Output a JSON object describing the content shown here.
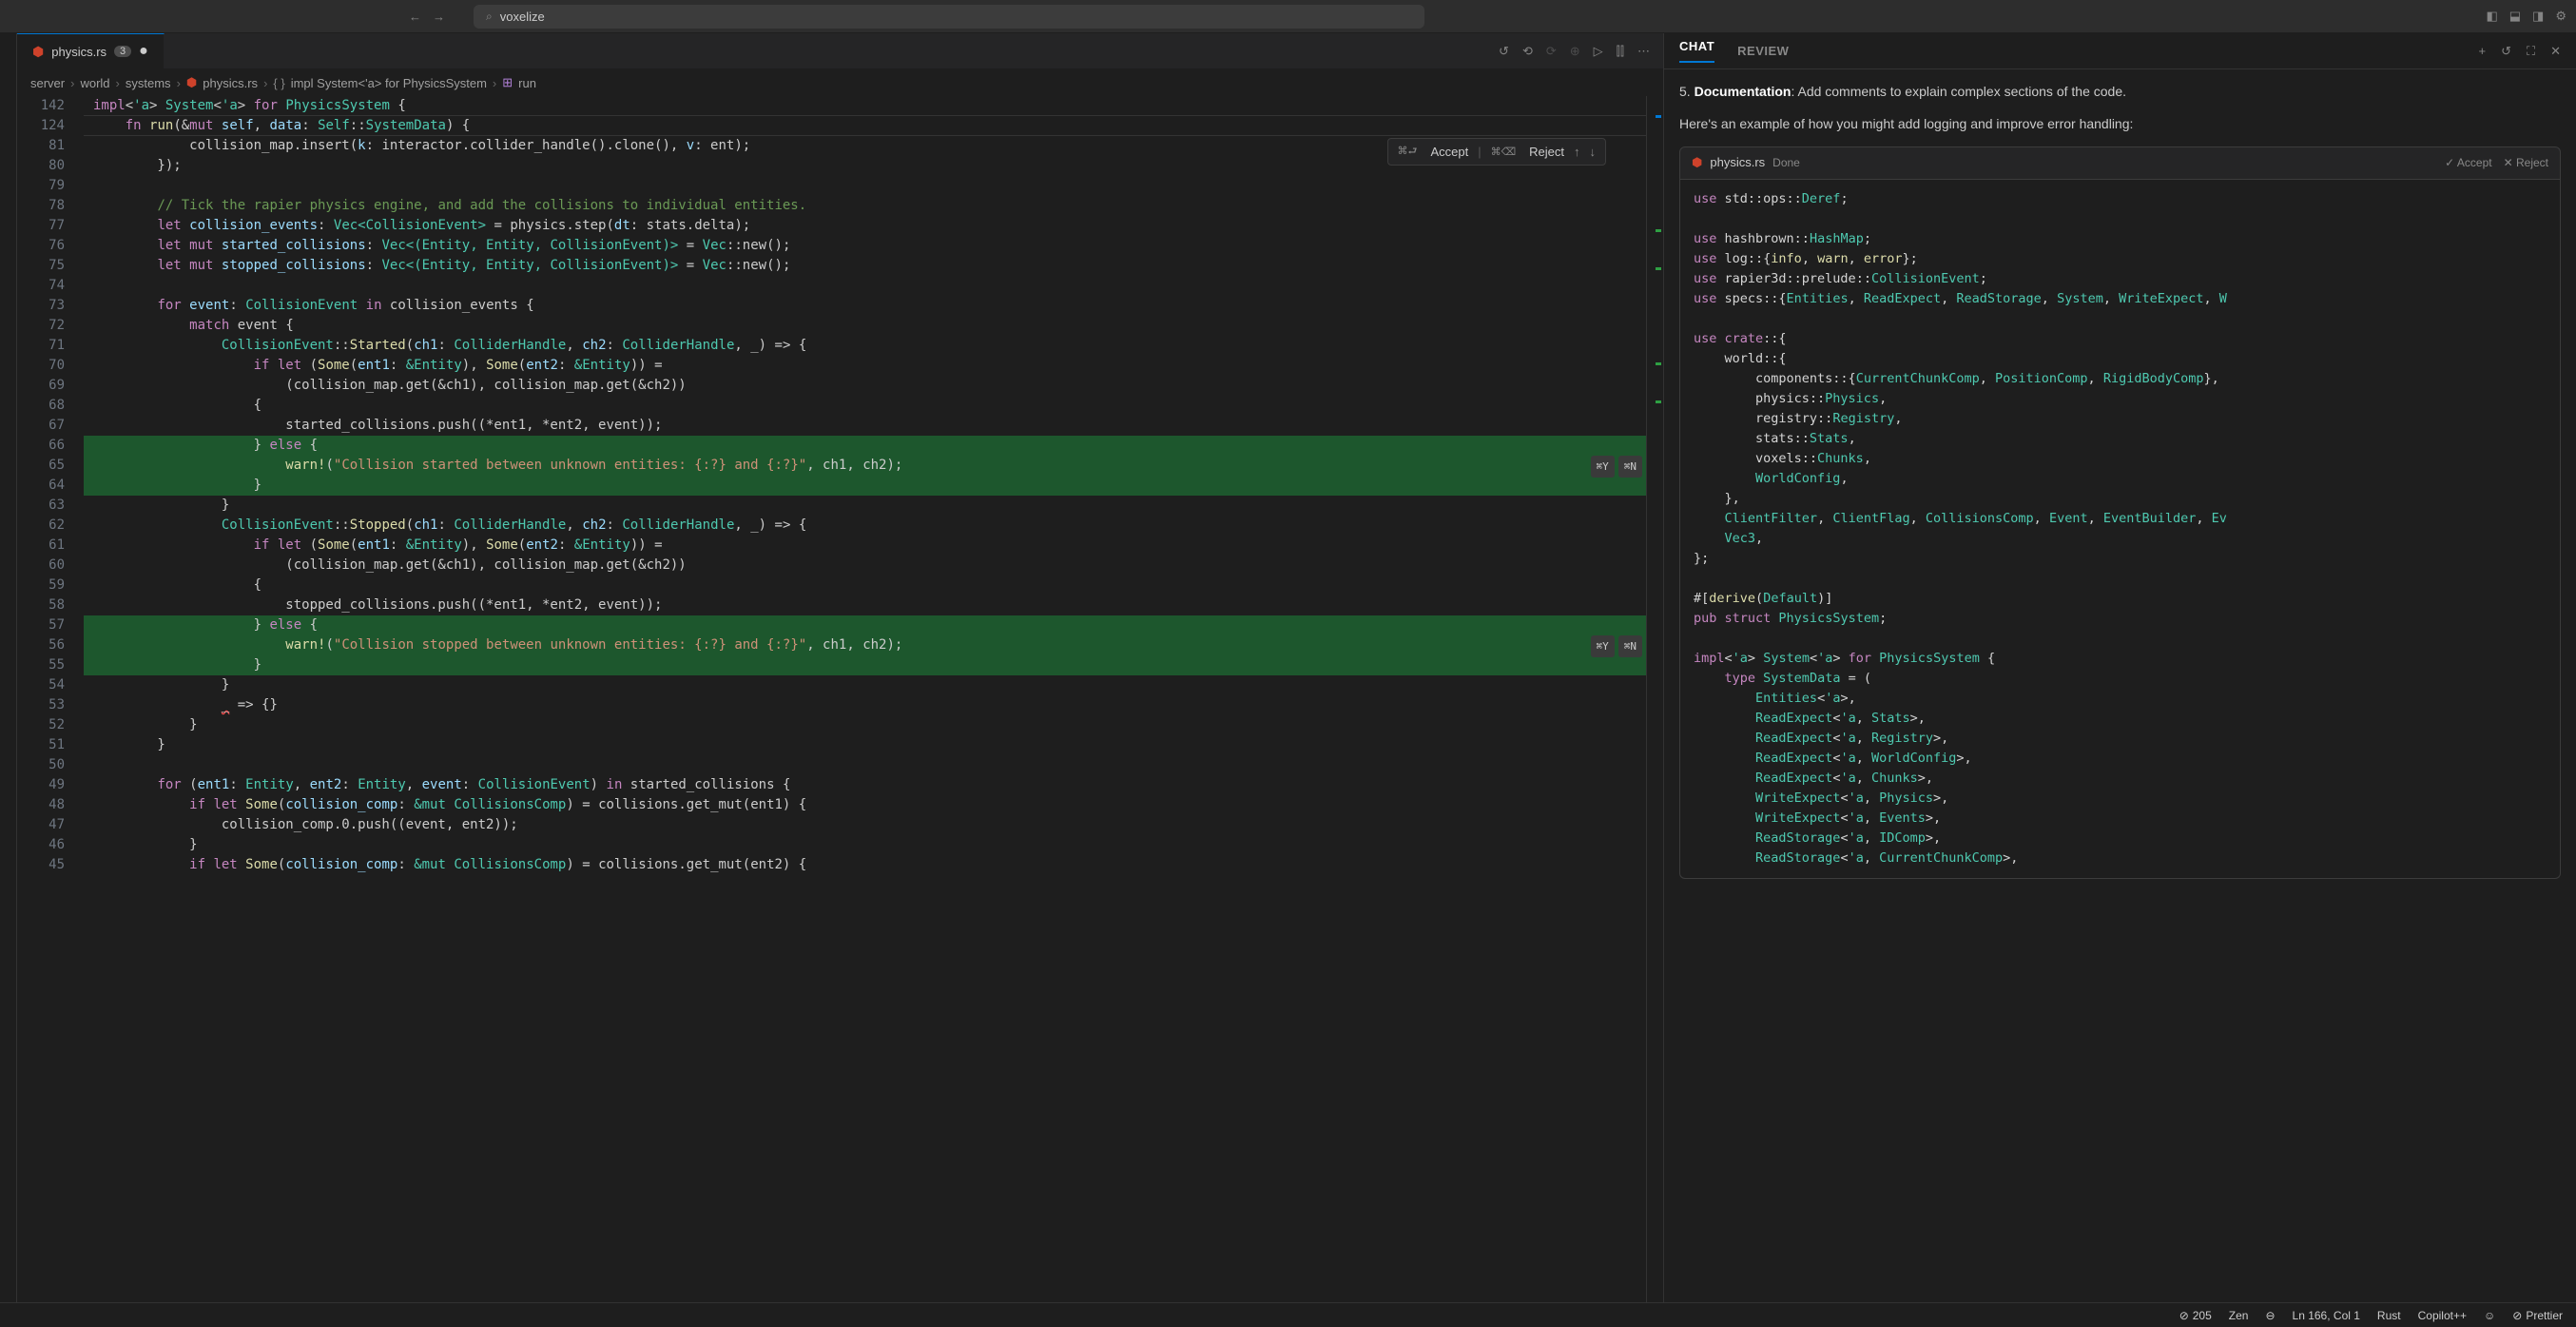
{
  "search_value": "voxelize",
  "tab": {
    "filename": "physics.rs",
    "badge": "3"
  },
  "breadcrumbs": [
    "server",
    "world",
    "systems",
    "physics.rs",
    "impl System<'a> for PhysicsSystem",
    "run"
  ],
  "accept_reject": {
    "accept_kbd": "⌘⮐",
    "accept": "Accept",
    "reject_kbd": "⌘⌫",
    "reject": "Reject"
  },
  "diff_hint": {
    "yes": "⌘Y",
    "no": "⌘N"
  },
  "gutter": [
    "142",
    "124",
    "",
    "81",
    "80",
    "79",
    "78",
    "77",
    "76",
    "75",
    "74",
    "73",
    "72",
    "71",
    "70",
    "69",
    "68",
    "67",
    "66",
    "65",
    "64",
    "63",
    "62",
    "61",
    "60",
    "59",
    "58",
    "57",
    "56",
    "55",
    "54",
    "53",
    "52",
    "51",
    "50",
    "49",
    "48",
    "47",
    "46",
    "45"
  ],
  "code": {
    "sticky1_html": "<span class='kw'>impl</span>&lt;<span class='ty'>'a</span>&gt; <span class='ty'>System</span>&lt;<span class='ty'>'a</span>&gt; <span class='kw'>for</span> <span class='ty'>PhysicsSystem</span> {",
    "sticky2_html": "    <span class='kw'>fn</span> <span class='fn-name'>run</span>(&amp;<span class='kw'>mut</span> <span class='var'>self</span>, <span class='var'>data</span>: <span class='ty'>Self</span>::<span class='ty'>SystemData</span>) {",
    "l3": "            collision_map.insert(<span class='var'>k</span>: interactor.collider_handle().clone(), <span class='var'>v</span>: ent);",
    "l4": "        });",
    "l5": "",
    "l6": "        <span class='cmt'>// Tick the rapier physics engine, and add the collisions to individual entities.</span>",
    "l7": "        <span class='kw'>let</span> <span class='var'>collision_events</span>: <span class='ty'>Vec&lt;CollisionEvent&gt;</span> = physics.step(<span class='var'>dt</span>: stats.delta);",
    "l8": "        <span class='kw'>let</span> <span class='kw'>mut</span> <span class='var'>started_collisions</span>: <span class='ty'>Vec&lt;(Entity, Entity, CollisionEvent)&gt;</span> = <span class='ty'>Vec</span>::new();",
    "l9": "        <span class='kw'>let</span> <span class='kw'>mut</span> <span class='var'>stopped_collisions</span>: <span class='ty'>Vec&lt;(Entity, Entity, CollisionEvent)&gt;</span> = <span class='ty'>Vec</span>::new();",
    "l10": "",
    "l11": "        <span class='kw'>for</span> <span class='var'>event</span>: <span class='ty'>CollisionEvent</span> <span class='kw'>in</span> collision_events {",
    "l12": "            <span class='kw'>match</span> event {",
    "l13": "                <span class='ty'>CollisionEvent</span>::<span class='fn-name'>Started</span>(<span class='var'>ch1</span>: <span class='ty'>ColliderHandle</span>, <span class='var'>ch2</span>: <span class='ty'>ColliderHandle</span>, _) =&gt; {",
    "l14": "                    <span class='kw'>if let</span> (<span class='fn-name'>Some</span>(<span class='var'>ent1</span>: <span class='ty'>&amp;Entity</span>), <span class='fn-name'>Some</span>(<span class='var'>ent2</span>: <span class='ty'>&amp;Entity</span>)) =",
    "l15": "                        (collision_map.get(&amp;ch1), collision_map.get(&amp;ch2))",
    "l16": "                    {",
    "l17": "                        started_collisions.push((*ent1, *ent2, event));",
    "l18": "                    } <span class='kw'>else</span> {",
    "l19": "                        <span class='fn-name'>warn!</span>(<span class='str'>\"Collision started between unknown entities: {:?} and {:?}\"</span>, ch1, ch2);",
    "l20": "                    }",
    "l21": "                }",
    "l22": "                <span class='ty'>CollisionEvent</span>::<span class='fn-name'>Stopped</span>(<span class='var'>ch1</span>: <span class='ty'>ColliderHandle</span>, <span class='var'>ch2</span>: <span class='ty'>ColliderHandle</span>, _) =&gt; {",
    "l23": "                    <span class='kw'>if let</span> (<span class='fn-name'>Some</span>(<span class='var'>ent1</span>: <span class='ty'>&amp;Entity</span>), <span class='fn-name'>Some</span>(<span class='var'>ent2</span>: <span class='ty'>&amp;Entity</span>)) =",
    "l24": "                        (collision_map.get(&amp;ch1), collision_map.get(&amp;ch2))",
    "l25": "                    {",
    "l26": "                        stopped_collisions.push((*ent1, *ent2, event));",
    "l27": "                    } <span class='kw'>else</span> {",
    "l28": "                        <span class='fn-name'>warn!</span>(<span class='str'>\"Collision stopped between unknown entities: {:?} and {:?}\"</span>, ch1, ch2);",
    "l29": "                    }",
    "l30": "                }",
    "l31": "                <span style='text-decoration:underline wavy #f14c4c;'>_</span> =&gt; {}",
    "l32": "            }",
    "l33": "        }",
    "l34": "",
    "l35": "        <span class='kw'>for</span> (<span class='var'>ent1</span>: <span class='ty'>Entity</span>, <span class='var'>ent2</span>: <span class='ty'>Entity</span>, <span class='var'>event</span>: <span class='ty'>CollisionEvent</span>) <span class='kw'>in</span> started_collisions {",
    "l36": "            <span class='kw'>if let</span> <span class='fn-name'>Some</span>(<span class='var'>collision_comp</span>: <span class='ty'>&amp;mut CollisionsComp</span>) = collisions.get_mut(ent1) {",
    "l37": "                collision_comp.0.push((event, ent2));",
    "l38": "            }",
    "l39": "            <span class='kw'>if let</span> <span class='fn-name'>Some</span>(<span class='var'>collision_comp</span>: <span class='ty'>&amp;mut CollisionsComp</span>) = collisions.get_mut(ent2) {"
  },
  "chat": {
    "tabs": {
      "chat": "CHAT",
      "review": "REVIEW"
    },
    "doc_line_num": "5.",
    "doc_line_bold": "Documentation",
    "doc_line_rest": ": Add comments to explain complex sections of the code.",
    "example_text": "Here's an example of how you might add logging and improve error handling:",
    "code_header": {
      "filename": "physics.rs",
      "status": "Done",
      "accept": "Accept",
      "reject": "Reject"
    },
    "code_html": "<span class='kw'>use</span> std::ops::<span class='ty'>Deref</span>;\n\n<span class='kw'>use</span> hashbrown::<span class='ty'>HashMap</span>;\n<span class='kw'>use</span> log::{<span class='fn-name'>info</span>, <span class='fn-name'>warn</span>, <span class='fn-name'>error</span>};\n<span class='kw'>use</span> rapier3d::prelude::<span class='ty'>CollisionEvent</span>;\n<span class='kw'>use</span> specs::{<span class='ty'>Entities</span>, <span class='ty'>ReadExpect</span>, <span class='ty'>ReadStorage</span>, <span class='ty'>System</span>, <span class='ty'>WriteExpect</span>, <span class='ty'>W</span>\n\n<span class='kw'>use</span> <span class='kw'>crate</span>::{\n    world::{\n        components::{<span class='ty'>CurrentChunkComp</span>, <span class='ty'>PositionComp</span>, <span class='ty'>RigidBodyComp</span>},\n        physics::<span class='ty'>Physics</span>,\n        registry::<span class='ty'>Registry</span>,\n        stats::<span class='ty'>Stats</span>,\n        voxels::<span class='ty'>Chunks</span>,\n        <span class='ty'>WorldConfig</span>,\n    },\n    <span class='ty'>ClientFilter</span>, <span class='ty'>ClientFlag</span>, <span class='ty'>CollisionsComp</span>, <span class='ty'>Event</span>, <span class='ty'>EventBuilder</span>, <span class='ty'>Ev</span>\n    <span class='ty'>Vec3</span>,\n};\n\n#[<span class='fn-name'>derive</span>(<span class='ty'>Default</span>)]\n<span class='kw'>pub struct</span> <span class='ty'>PhysicsSystem</span>;\n\n<span class='kw'>impl</span>&lt;<span class='ty'>'a</span>&gt; <span class='ty'>System</span>&lt;<span class='ty'>'a</span>&gt; <span class='kw'>for</span> <span class='ty'>PhysicsSystem</span> {\n    <span class='kw'>type</span> <span class='ty'>SystemData</span> = (\n        <span class='ty'>Entities</span>&lt;<span class='ty'>'a</span>&gt;,\n        <span class='ty'>ReadExpect</span>&lt;<span class='ty'>'a</span>, <span class='ty'>Stats</span>&gt;,\n        <span class='ty'>ReadExpect</span>&lt;<span class='ty'>'a</span>, <span class='ty'>Registry</span>&gt;,\n        <span class='ty'>ReadExpect</span>&lt;<span class='ty'>'a</span>, <span class='ty'>WorldConfig</span>&gt;,\n        <span class='ty'>ReadExpect</span>&lt;<span class='ty'>'a</span>, <span class='ty'>Chunks</span>&gt;,\n        <span class='ty'>WriteExpect</span>&lt;<span class='ty'>'a</span>, <span class='ty'>Physics</span>&gt;,\n        <span class='ty'>WriteExpect</span>&lt;<span class='ty'>'a</span>, <span class='ty'>Events</span>&gt;,\n        <span class='ty'>ReadStorage</span>&lt;<span class='ty'>'a</span>, <span class='ty'>IDComp</span>&gt;,\n        <span class='ty'>ReadStorage</span>&lt;<span class='ty'>'a</span>, <span class='ty'>CurrentChunkComp</span>&gt;,"
  },
  "statusbar": {
    "errors": "205",
    "zen": "Zen",
    "position": "Ln 166, Col 1",
    "language": "Rust",
    "copilot": "Copilot++",
    "prettier": "Prettier"
  }
}
